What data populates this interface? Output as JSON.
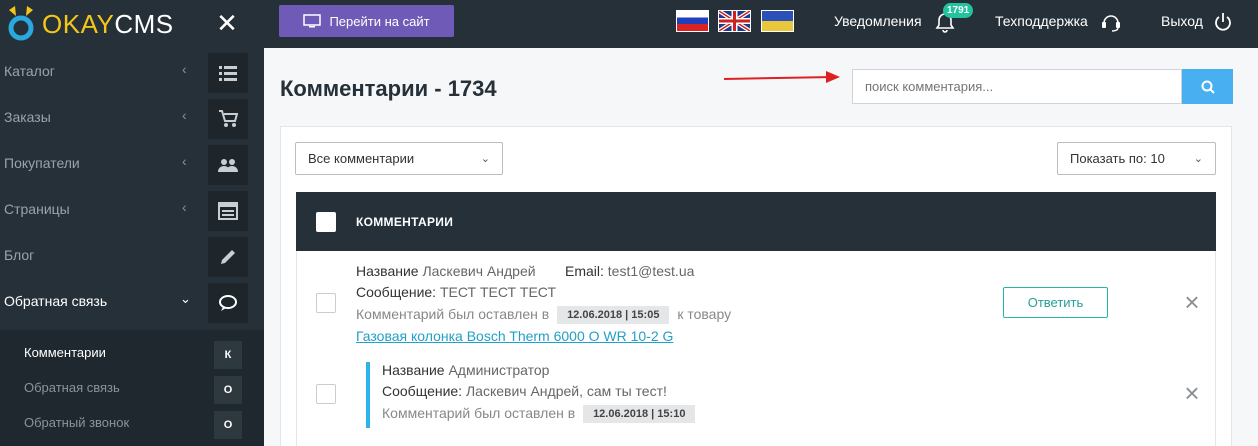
{
  "brand": {
    "ok": "OKAY",
    "cms": "CMS",
    "close": "✕"
  },
  "sidebar": {
    "items": [
      {
        "label": "Каталог",
        "icon": "list-icon"
      },
      {
        "label": "Заказы",
        "icon": "cart-icon"
      },
      {
        "label": "Покупатели",
        "icon": "users-icon"
      },
      {
        "label": "Страницы",
        "icon": "pages-icon"
      },
      {
        "label": "Блог",
        "icon": "pencil-icon"
      },
      {
        "label": "Обратная связь",
        "icon": "chat-icon",
        "active": true
      }
    ],
    "sub_items": [
      {
        "label": "Комментарии",
        "badge": "К",
        "active": true
      },
      {
        "label": "Обратная связь",
        "badge": "О"
      },
      {
        "label": "Обратный звонок",
        "badge": "О"
      }
    ]
  },
  "topbar": {
    "site_button": "Перейти на сайт",
    "notifications_label": "Уведомления",
    "notifications_count": "1791",
    "support_label": "Техподдержка",
    "logout_label": "Выход"
  },
  "page": {
    "title": "Комментарии - 1734",
    "search_placeholder": "поиск комментария...",
    "filter_value": "Все комментарии",
    "per_page_value": "Показать по: 10"
  },
  "table": {
    "header": "КОММЕНТАРИИ",
    "comments": [
      {
        "name_label": "Название",
        "name": "Ласкевич Андрей",
        "email_label": "Email:",
        "email": "test1@test.ua",
        "message_label": "Сообщение:",
        "message": "ТЕСТ ТЕСТ ТЕСТ",
        "left_label": "Комментарий был оставлен в",
        "date": "12.06.2018 | 15:05",
        "to_product": "к товару",
        "product_link": "Газовая колонка Bosch Therm 6000 O WR 10-2 G",
        "reply_button": "Ответить"
      },
      {
        "name_label": "Название",
        "name": "Администратор",
        "message_label": "Сообщение:",
        "message": "Ласкевич Андрей, сам ты тест!",
        "left_label": "Комментарий был оставлен в",
        "date": "12.06.2018 | 15:10"
      }
    ]
  },
  "colors": {
    "sidebar": "#263038",
    "accent": "#6f5bb7",
    "search": "#48b0f0",
    "reply": "#23b7a8",
    "annotation": "#e02020"
  }
}
